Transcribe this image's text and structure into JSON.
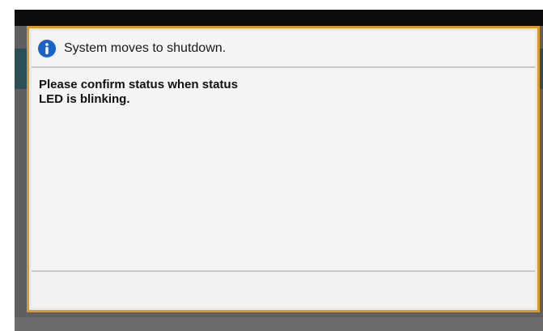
{
  "dialog": {
    "icon": "info-icon",
    "title": "System moves to shutdown.",
    "message": "Please confirm status when status\nLED is blinking."
  },
  "colors": {
    "dialog_border": "#d89a2c",
    "info_icon": "#1a63c9",
    "top_bar": "#0c0c0c",
    "background_band": "#2c4e55"
  }
}
